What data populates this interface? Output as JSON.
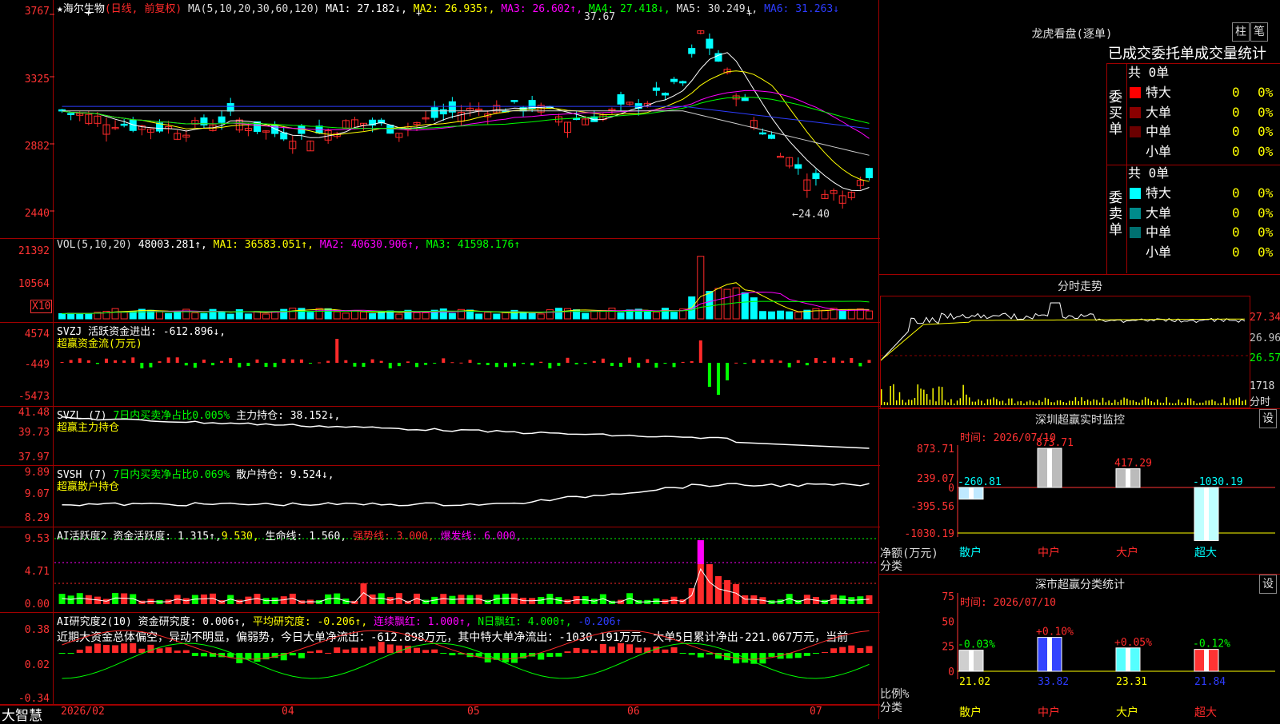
{
  "colors": {
    "up": "#ff2a2a",
    "down": "#00ffff",
    "yellow": "#ffff00",
    "white": "#ffffff",
    "magenta": "#ff00ff",
    "green": "#00ff00",
    "blue": "#2d3cff",
    "grid": "#8b0000",
    "axis": "#ff3333"
  },
  "main": {
    "star": "★",
    "stock": "海尔生物",
    "mode": "(日线, 前复权)",
    "ma_label": "MA(5,10,20,30,60,120)",
    "ma1": "MA1: 27.182↓,",
    "ma2": "MA2: 26.935↑,",
    "ma3": "MA3: 26.602↑,",
    "ma4": "MA4: 27.418↓,",
    "ma5": "MA5: 30.249↓,",
    "ma6": "MA6: 31.263↓",
    "high_label": "37.67",
    "low_label": "←24.40",
    "y_ticks": [
      "3767",
      "3325",
      "2882",
      "2440"
    ]
  },
  "vol": {
    "label": "VOL(5,10,20)",
    "value": "48003.281↑,",
    "ma1": "MA1: 36583.051↑,",
    "ma2": "MA2: 40630.906↑,",
    "ma3": "MA3: 41598.176↑",
    "y_ticks": [
      "21392",
      "10564"
    ],
    "unit": "X10"
  },
  "svzj": {
    "label": "SVZJ 活跃资金进出: -612.896↓,",
    "sub": "超赢资金流(万元)",
    "y_ticks": [
      "4574",
      "-449",
      "-5473"
    ]
  },
  "svzl": {
    "label": "SVZL (7)",
    "part1": "7日内买卖净占比0.005%",
    "part2": "主力持仓: 38.152↓,",
    "sub": "超赢主力持仓",
    "y_ticks": [
      "41.48",
      "39.73",
      "37.97"
    ]
  },
  "svsh": {
    "label": "SVSH (7)",
    "part1": "7日内买卖净占比0.069%",
    "part2": "散户持仓: 9.524↓,",
    "sub": "超赢散户持仓",
    "y_ticks": [
      "9.89",
      "9.07",
      "8.29"
    ]
  },
  "ai1": {
    "label": "AI活跃度2 资金活跃度: 1.315↑,",
    "v2": "9.530,",
    "life": "生命线: 1.560,",
    "strong": "强势线: 3.000,",
    "burst": "爆发线: 6.000,",
    "y_ticks": [
      "9.53",
      "4.71",
      "0.00"
    ]
  },
  "ai2": {
    "label": "AI研究度2(10) 资金研究度: 0.006↑,",
    "avg": "平均研究度: -0.206↑,",
    "lian": "连续飘红: 1.000↑,",
    "nday": "N日飘红: 4.000↑,",
    "last": "-0.206↑",
    "text": "近期大资金总体偏空，异动不明显，偏弱势，今日大单净流出：-612.898万元，其中特大单净流出：-1030.191万元，大单5日累计净出-221.067万元，当前",
    "y_ticks": [
      "0.38",
      "0.02",
      "-0.34"
    ]
  },
  "xaxis": {
    "labels": [
      "2026/02",
      "04",
      "05",
      "06",
      "07"
    ]
  },
  "brand": "大智慧",
  "right": {
    "dragon_title": "龙虎看盘(逐单)",
    "btn1": "柱",
    "btn2": "笔",
    "stats_title": "已成交委托单成交量统计",
    "buy_label": "委买单",
    "sell_label": "委卖单",
    "buy_total": "共 0单",
    "sell_total": "共 0单",
    "buy_rows": [
      {
        "name": "特大",
        "n": "0",
        "p": "0%"
      },
      {
        "name": "大单",
        "n": "0",
        "p": "0%"
      },
      {
        "name": "中单",
        "n": "0",
        "p": "0%"
      },
      {
        "name": "小单",
        "n": "0",
        "p": "0%"
      }
    ],
    "sell_rows": [
      {
        "name": "特大",
        "n": "0",
        "p": "0%"
      },
      {
        "name": "大单",
        "n": "0",
        "p": "0%"
      },
      {
        "name": "中单",
        "n": "0",
        "p": "0%"
      },
      {
        "name": "小单",
        "n": "0",
        "p": "0%"
      }
    ],
    "intraday_title": "分时走势",
    "intraday_ticks": [
      "27.34",
      "26.96",
      "26.57"
    ],
    "intraday_vol": "1718",
    "intraday_unit": "分时",
    "monitor_title": "深圳超赢实时监控",
    "setting": "设",
    "monitor_time": "时间: 2026/07/10",
    "monitor_ticks": [
      "873.71",
      "239.07",
      "0",
      "-395.56",
      "-1030.19"
    ],
    "monitor_ylabel": "净额(万元)",
    "monitor_xlabel": "分类",
    "monitor_bars": [
      {
        "cat": "散户",
        "value": -260.81,
        "label": "-260.81"
      },
      {
        "cat": "中户",
        "value": 873.71,
        "label": "873.71"
      },
      {
        "cat": "大户",
        "value": 417.29,
        "label": "417.29"
      },
      {
        "cat": "超大",
        "value": -1030.19,
        "label": "-1030.19"
      }
    ],
    "class_title": "深市超赢分类统计",
    "class_time": "时间: 2026/07/10",
    "class_ticks": [
      "75",
      "50",
      "25",
      "0"
    ],
    "class_ylabel": "比例%",
    "class_xlabel": "分类",
    "class_bars": [
      {
        "cat": "散户",
        "value": 21.02,
        "label": "21.02",
        "delta": "-0.03%",
        "color": "#cfcfcf"
      },
      {
        "cat": "中户",
        "value": 33.82,
        "label": "33.82",
        "delta": "+0.10%",
        "color": "#3344ff"
      },
      {
        "cat": "大户",
        "value": 23.31,
        "label": "23.31",
        "delta": "+0.05%",
        "color": "#55ffff"
      },
      {
        "cat": "超大",
        "value": 21.84,
        "label": "21.84",
        "delta": "-0.12%",
        "color": "#ff3333"
      }
    ]
  }
}
